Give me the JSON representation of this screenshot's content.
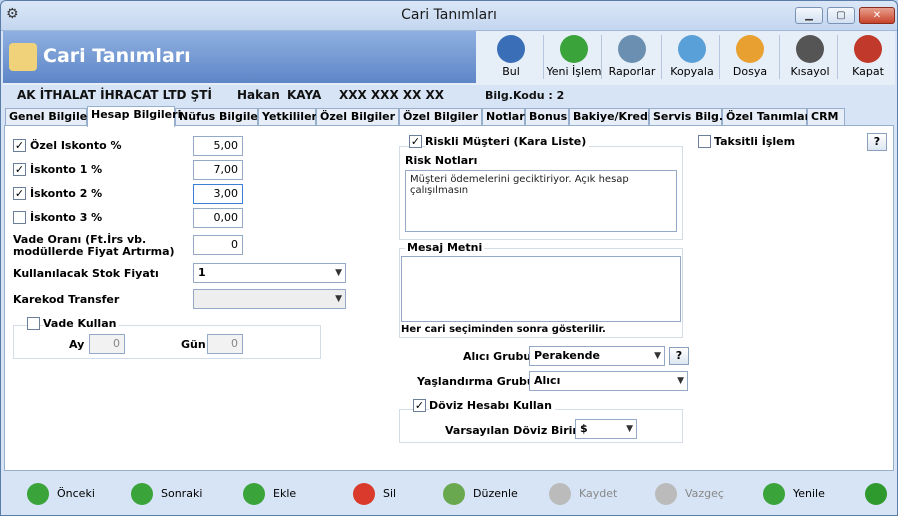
{
  "window": {
    "title": "Cari Tanımları",
    "minimize": "▁",
    "maximize": "▢",
    "close": "✕"
  },
  "header": {
    "title": "Cari Tanımları"
  },
  "toolbar": [
    {
      "label": "Bul",
      "icon": "search-person-icon",
      "color": "#3a6fb7"
    },
    {
      "label": "Yeni İşlem",
      "icon": "add-icon",
      "color": "#3aa33a"
    },
    {
      "label": "Raporlar",
      "icon": "report-icon",
      "color": "#6b8fb0"
    },
    {
      "label": "Kopyala",
      "icon": "copy-icon",
      "color": "#5aa0d8"
    },
    {
      "label": "Dosya",
      "icon": "folder-icon",
      "color": "#e8a030"
    },
    {
      "label": "Kısayol",
      "icon": "keyboard-icon",
      "color": "#555555"
    },
    {
      "label": "Kapat",
      "icon": "close-door-icon",
      "color": "#c0392b"
    }
  ],
  "company": {
    "name": "AK İTHALAT İHRACAT LTD ŞTİ",
    "first": "Hakan",
    "last": "KAYA",
    "phone": "XXX XXX XX XX",
    "code": "Bilg.Kodu : 2"
  },
  "tabs": [
    "Genel Bilgiler",
    "Hesap Bilgileri",
    "Nüfus Bilgileri",
    "Yetkililer",
    "Özel Bilgiler 1",
    "Özel Bilgiler 2",
    "Notlar",
    "Bonus",
    "Bakiye/Kredi",
    "Servis Bilg.",
    "Özel Tanımlar",
    "CRM"
  ],
  "form": {
    "ozel_iskonto": {
      "label": "Özel Iskonto %",
      "value": "5,00",
      "checked": true
    },
    "iskonto1": {
      "label": "İskonto 1 %",
      "value": "7,00",
      "checked": true
    },
    "iskonto2": {
      "label": "İskonto 2 %",
      "value": "3,00",
      "checked": true
    },
    "iskonto3": {
      "label": "İskonto 3 %",
      "value": "0,00",
      "checked": false
    },
    "vade_orani": {
      "label": "Vade Oranı (Ft.İrs vb. modüllerde Fiyat Artırma)",
      "value": "0"
    },
    "stok_fiyati": {
      "label": "Kullanılacak Stok Fiyatı",
      "value": "1"
    },
    "karekod": {
      "label": "Karekod Transfer",
      "value": ""
    },
    "vade_kullan": {
      "label": "Vade Kullan",
      "checked": false,
      "ay_label": "Ay",
      "ay": "0",
      "gun_label": "Gün",
      "gun": "0"
    },
    "riskli": {
      "label": "Riskli Müşteri (Kara Liste)",
      "checked": true
    },
    "risk_notlari": {
      "label": "Risk Notları",
      "value": "Müşteri ödemelerini geciktiriyor. Açık hesap çalışılmasın"
    },
    "mesaj": {
      "label": "Mesaj Metni",
      "value": "",
      "note": "Her cari seçiminden sonra gösterilir."
    },
    "alici_grubu": {
      "label": "Alıcı Grubu",
      "value": "Perakende"
    },
    "yaslandirma": {
      "label": "Yaşlandırma Grubu",
      "value": "Alıcı"
    },
    "doviz": {
      "label": "Döviz Hesabı Kullan",
      "checked": true,
      "birim_label": "Varsayılan Döviz Birimi",
      "birim": "$"
    },
    "taksitli": {
      "label": "Taksitli İşlem",
      "checked": false
    },
    "help": "?"
  },
  "bottom": [
    {
      "label": "Önceki",
      "icon": "prev-icon",
      "color": "#3aa33a",
      "enabled": true
    },
    {
      "label": "Sonraki",
      "icon": "next-icon",
      "color": "#3aa33a",
      "enabled": true
    },
    {
      "label": "Ekle",
      "icon": "add-icon",
      "color": "#3aa33a",
      "enabled": true
    },
    {
      "label": "Sil",
      "icon": "delete-icon",
      "color": "#d93a2b",
      "enabled": true
    },
    {
      "label": "Düzenle",
      "icon": "edit-icon",
      "color": "#6aa84f",
      "enabled": true
    },
    {
      "label": "Kaydet",
      "icon": "check-icon",
      "color": "#bbbbbb",
      "enabled": false
    },
    {
      "label": "Vazgeç",
      "icon": "cancel-icon",
      "color": "#bbbbbb",
      "enabled": false
    },
    {
      "label": "Yenile",
      "icon": "refresh-icon",
      "color": "#3aa33a",
      "enabled": true
    },
    {
      "label": "",
      "icon": "up-arrow-icon",
      "color": "#2e9a2e",
      "enabled": true
    }
  ]
}
